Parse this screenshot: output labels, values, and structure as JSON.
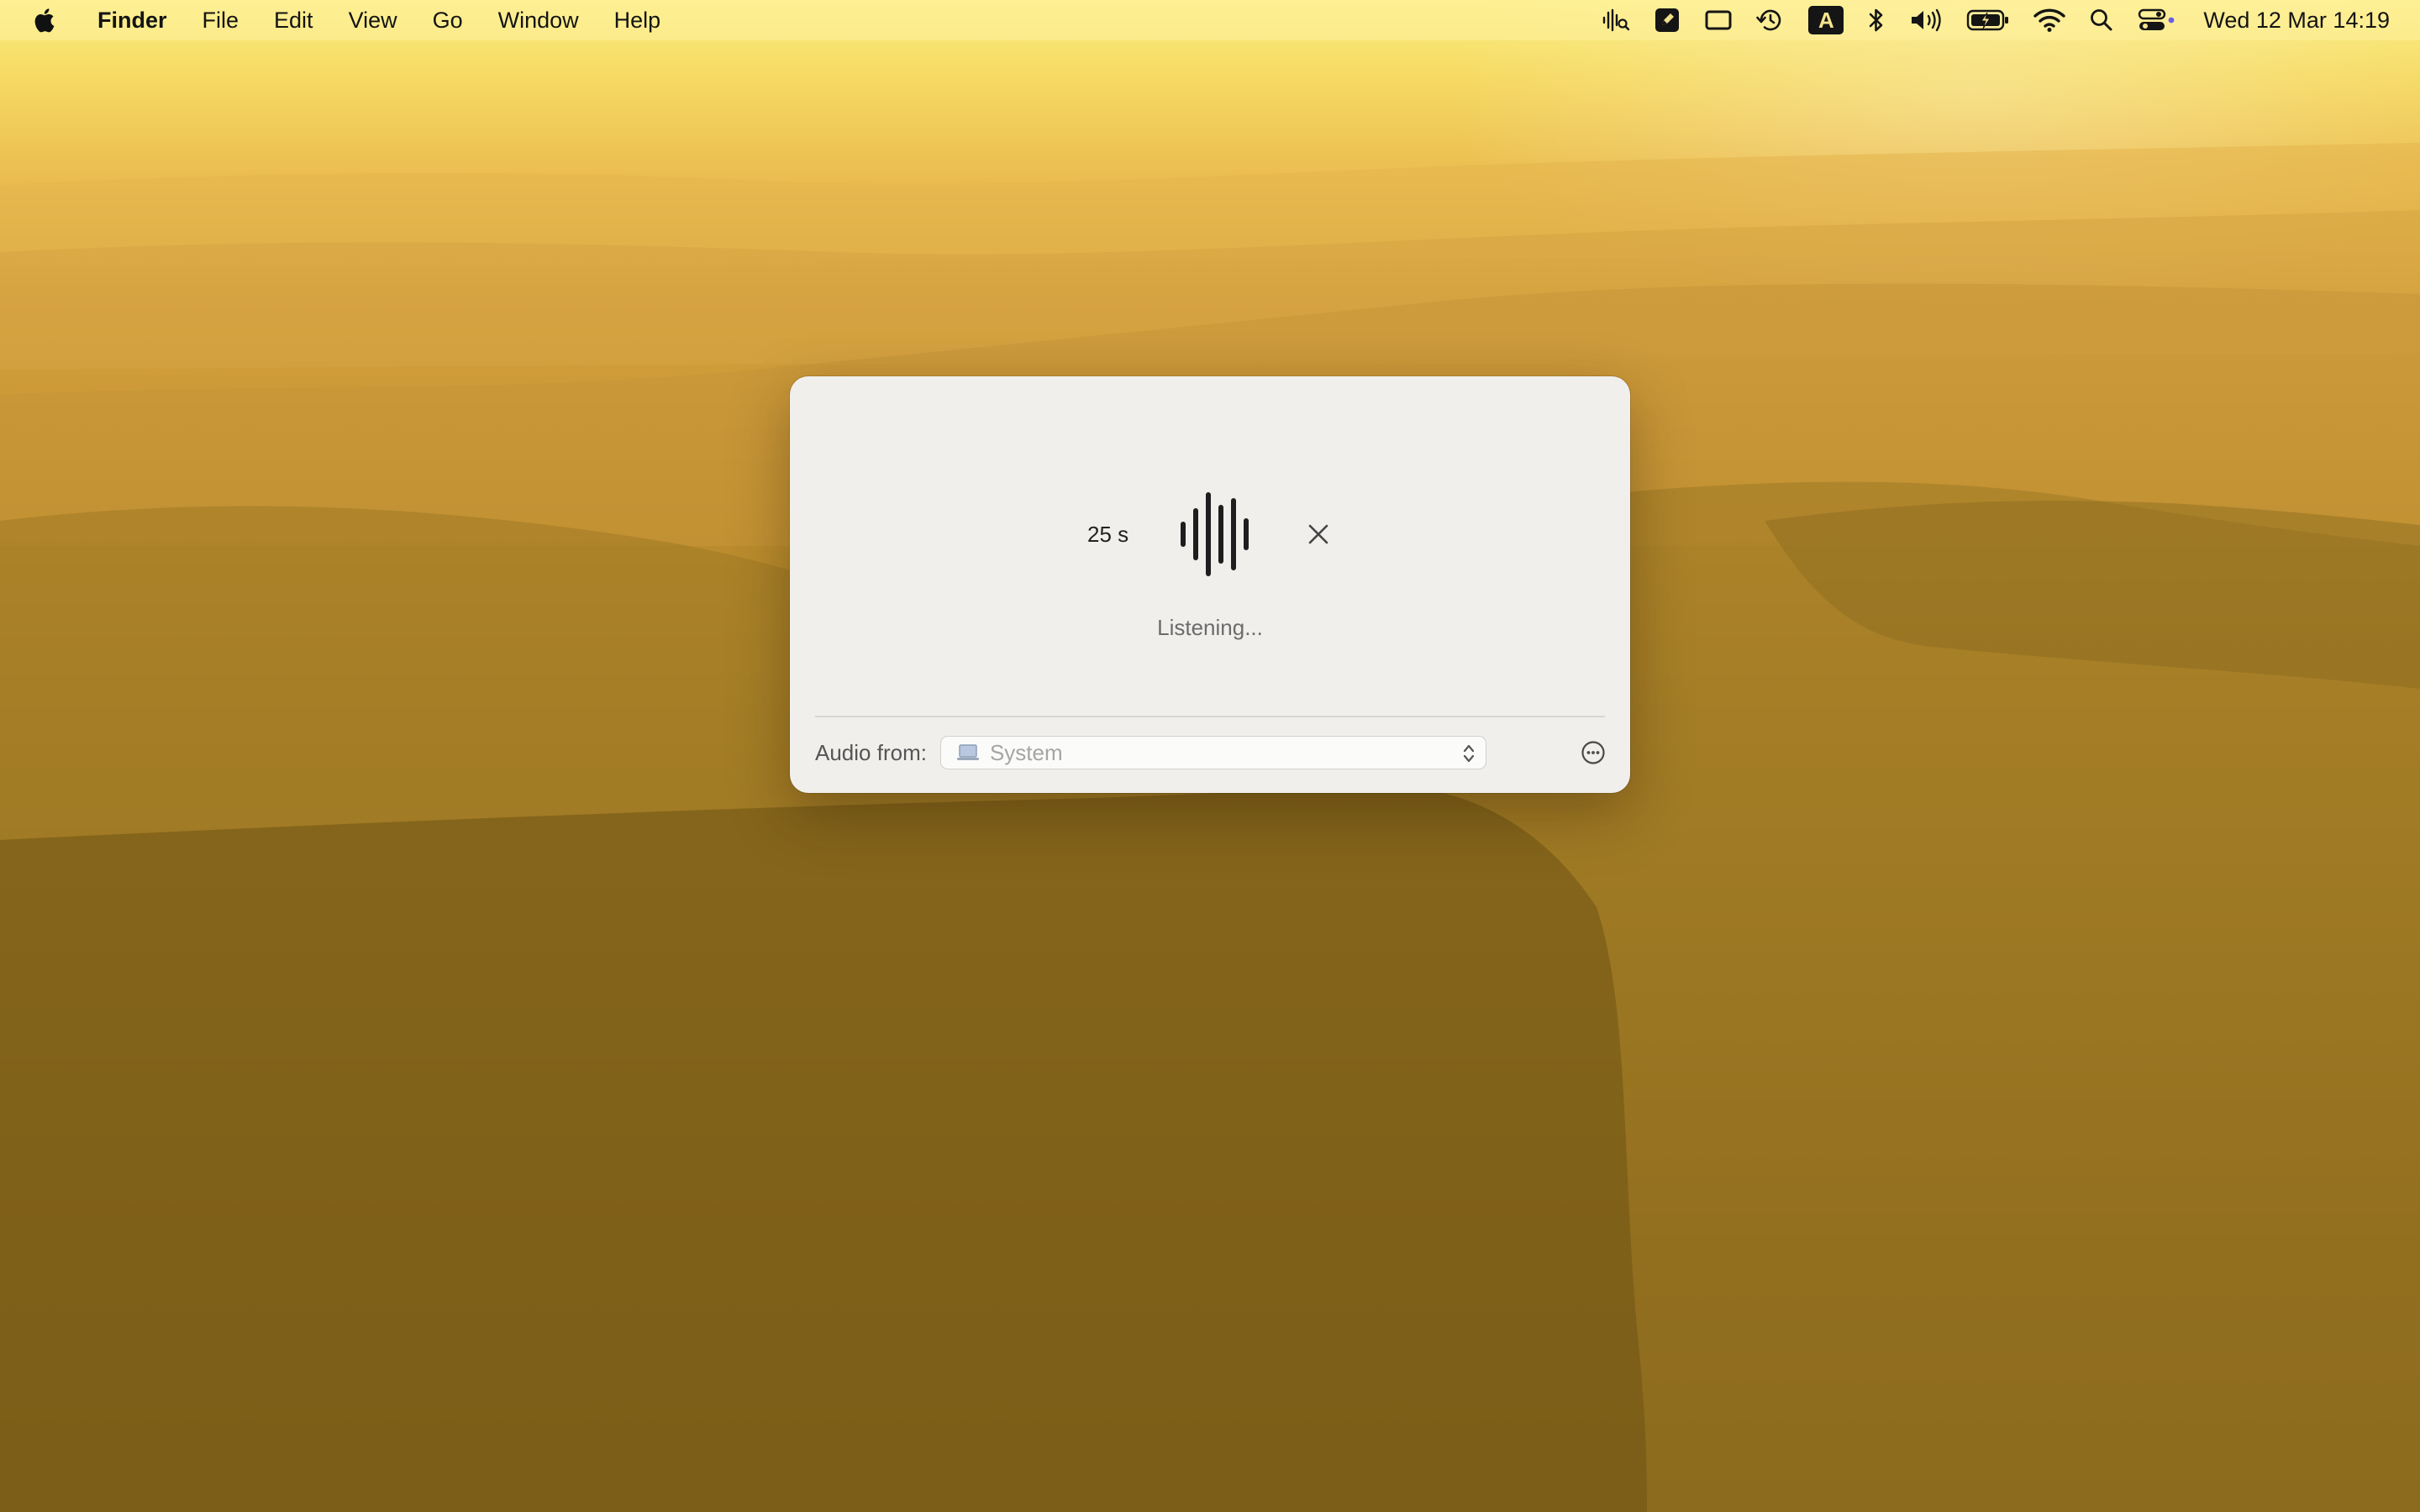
{
  "menubar": {
    "app_name": "Finder",
    "menus": [
      "File",
      "Edit",
      "View",
      "Go",
      "Window",
      "Help"
    ],
    "status_icons": [
      "audio-waveform-icon",
      "stage-manager-icon",
      "screen-mirror-icon",
      "time-machine-icon",
      "input-source-icon",
      "bluetooth-icon",
      "volume-icon",
      "battery-icon",
      "wifi-icon",
      "spotlight-icon",
      "control-center-icon"
    ],
    "input_source_letter": "A",
    "clock": "Wed 12 Mar  14:19"
  },
  "dialog": {
    "timer": "25 s",
    "status": "Listening...",
    "audio_from_label": "Audio from:",
    "audio_source": "System"
  },
  "colors": {
    "dialog_bg": "#f0efec",
    "wallpaper_top": "#fbef82",
    "wallpaper_bottom": "#6d5312"
  }
}
